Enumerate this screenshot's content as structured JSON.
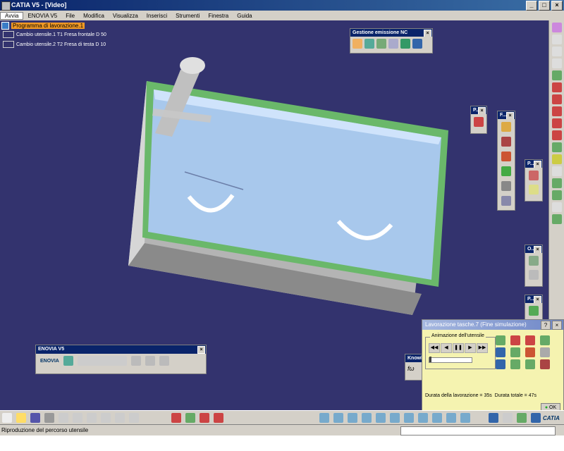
{
  "window": {
    "title": "CATIA V5 - [Video]",
    "buttons": [
      "_",
      "□",
      "×"
    ]
  },
  "menu": {
    "items": [
      "Avvia",
      "ENOVIA V5",
      "File",
      "Modifica",
      "Visualizza",
      "Inserisci",
      "Strumenti",
      "Finestra",
      "Guida"
    ]
  },
  "tree": {
    "root": "Programma di lavorazione.1",
    "nodes": [
      {
        "label": "Cambio utensile.1  T1 Fresa frontale D 50"
      },
      {
        "label": "Cambio utensile.2  T2 Fresa di testa D 10"
      }
    ]
  },
  "toolbars": {
    "nc": {
      "title": "Gestione emissione NC",
      "close": "×"
    },
    "p1": {
      "title": "P...",
      "close": "×"
    },
    "f": {
      "title": "F...",
      "close": "×"
    },
    "p2": {
      "title": "P...",
      "close": "×"
    },
    "o": {
      "title": "O...",
      "close": "×"
    },
    "p3": {
      "title": "P...",
      "close": "×"
    },
    "enovia": {
      "title": "ENOVIA V5",
      "close": "×",
      "brand": "ENOVIA"
    },
    "knowledge": {
      "title": "Knowl",
      "icon_text": "fω"
    }
  },
  "dialog": {
    "title": "Lavorazione tasche.7 (Fine simulazione)",
    "help": "?",
    "close": "×",
    "group_label": "Animazione dell'utensile",
    "duration_machining": "Durata della lavorazione = 35s",
    "duration_total": "Durata totale = 47s",
    "ok": "OK",
    "slider_position": 0.0
  },
  "status": {
    "text": "Riproduzione del percorso utensile"
  },
  "brand": {
    "catia": "CATIA"
  },
  "colors": {
    "background": "#33336e",
    "part_body": "#a8c8ec",
    "part_edge": "#6ab86a",
    "tool": "#c0c0c0",
    "highlight": "#f29a25"
  }
}
